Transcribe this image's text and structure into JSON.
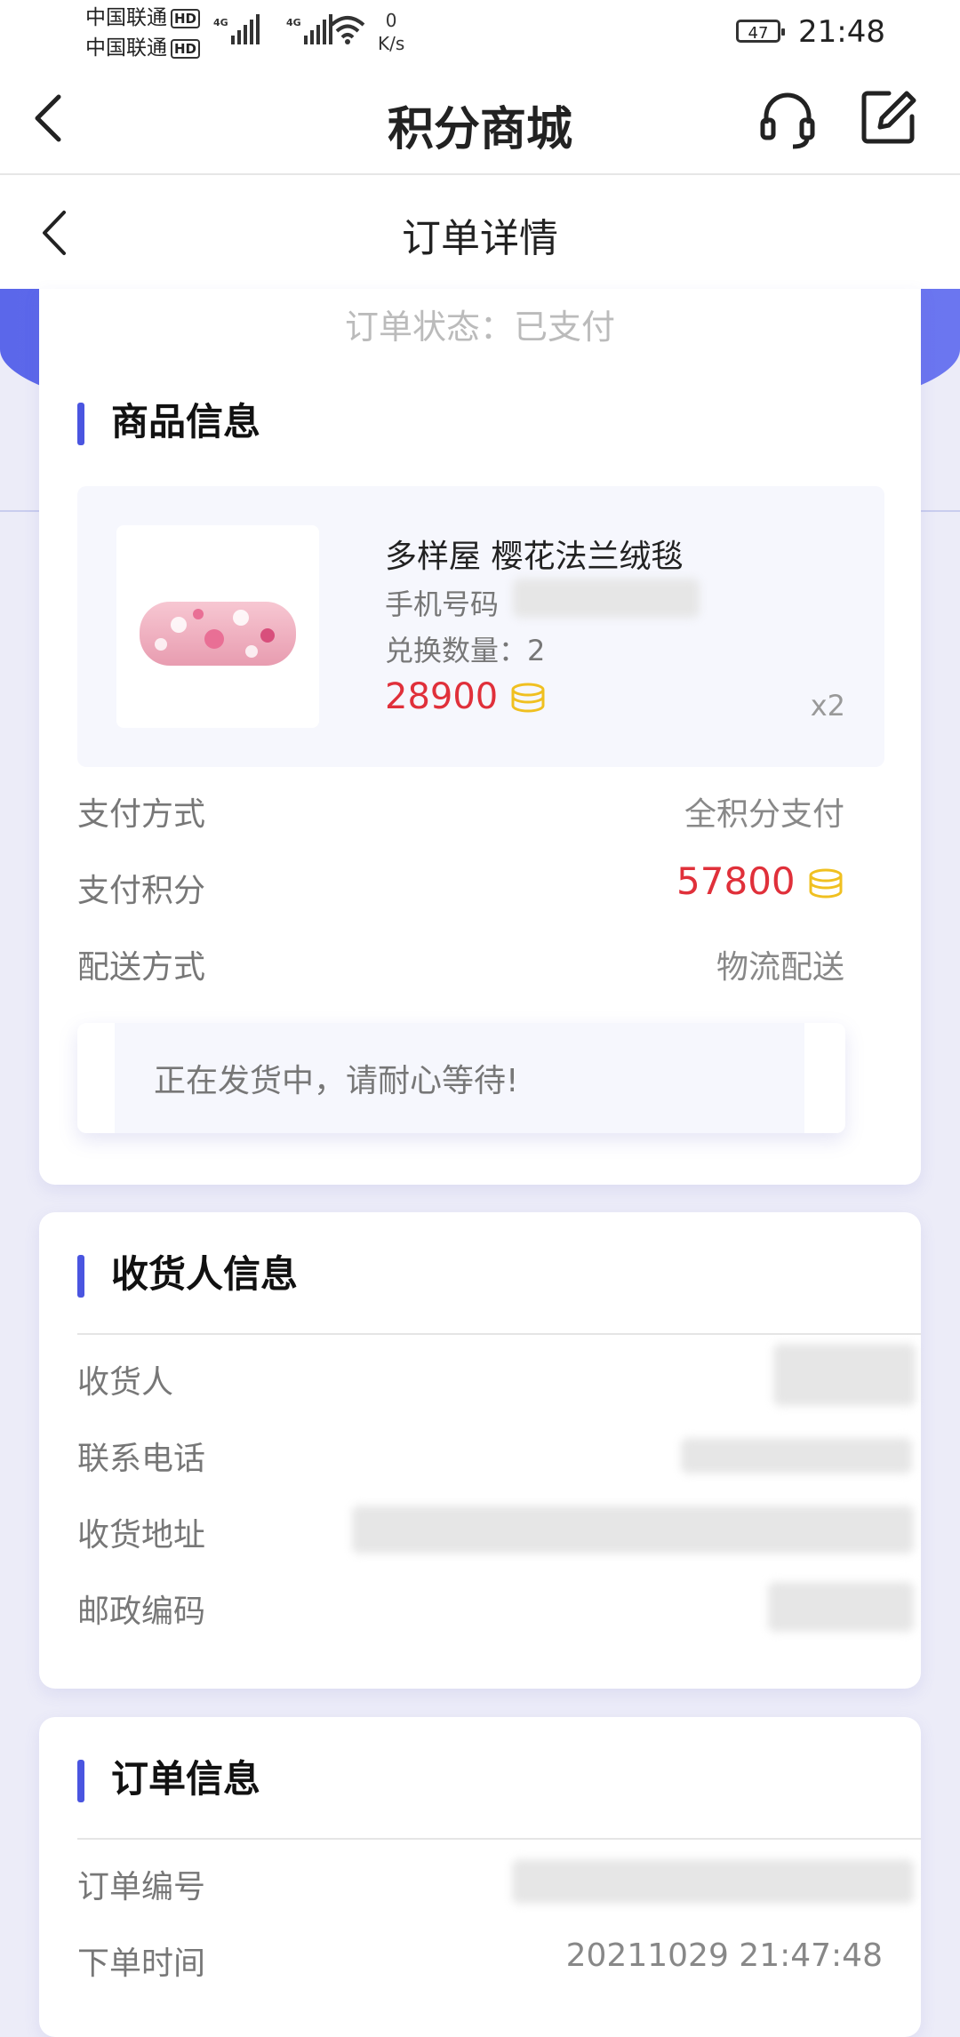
{
  "status_bar": {
    "carrier1": "中国联通",
    "carrier2": "中国联通",
    "hd_badge": "HD",
    "net1": "4G",
    "net2": "4G",
    "speed_value": "0",
    "speed_unit": "K/s",
    "battery": "47",
    "time": "21:48"
  },
  "app_bar": {
    "title": "积分商城"
  },
  "sub_bar": {
    "title": "订单详情"
  },
  "order_status": "订单状态：已支付",
  "goods": {
    "section_title": "商品信息",
    "product": {
      "name": "多样屋 樱花法兰绒毯",
      "phone_label": "手机号码",
      "qty_text": "兑换数量：2",
      "price": "28900",
      "multiplier": "x2"
    },
    "pay_method_label": "支付方式",
    "pay_method_value": "全积分支付",
    "pay_points_label": "支付积分",
    "pay_points_value": "57800",
    "delivery_label": "配送方式",
    "delivery_value": "物流配送",
    "notice": "正在发货中，请耐心等待!"
  },
  "receiver": {
    "section_title": "收货人信息",
    "name_label": "收货人",
    "phone_label": "联系电话",
    "address_label": "收货地址",
    "postcode_label": "邮政编码"
  },
  "order_info": {
    "section_title": "订单信息",
    "order_no_label": "订单编号",
    "time_label": "下单时间",
    "time_value": "20211029 21:47:48"
  },
  "colors": {
    "accent": "#4a55e0",
    "price_red": "#e0303a",
    "coin_gold": "#f0c020"
  }
}
